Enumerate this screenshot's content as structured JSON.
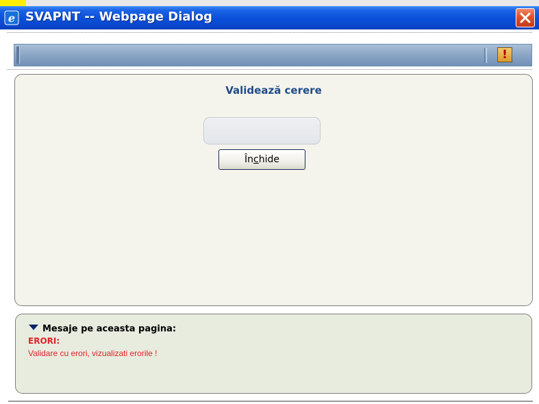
{
  "window": {
    "title": "SVAPNT -- Webpage Dialog",
    "app_icon": "ie-icon",
    "close_icon": "close-icon",
    "title_bar_color": "#0a4fd9",
    "close_color": "#e0502a"
  },
  "toolbar": {
    "alert_icon": "exclamation-icon",
    "alert_glyph": "!"
  },
  "main": {
    "title": "Validează cerere",
    "field_value": "",
    "close_button": {
      "label_prefix": "În",
      "label_accel": "c",
      "label_suffix": "hide"
    }
  },
  "messages": {
    "header": "Mesaje pe aceasta pagina:",
    "collapse_icon": "triangle-down-icon",
    "label": "ERORI:",
    "text": "Validare cu erori, vizualizati erorile !",
    "error_color": "#e0242a"
  }
}
